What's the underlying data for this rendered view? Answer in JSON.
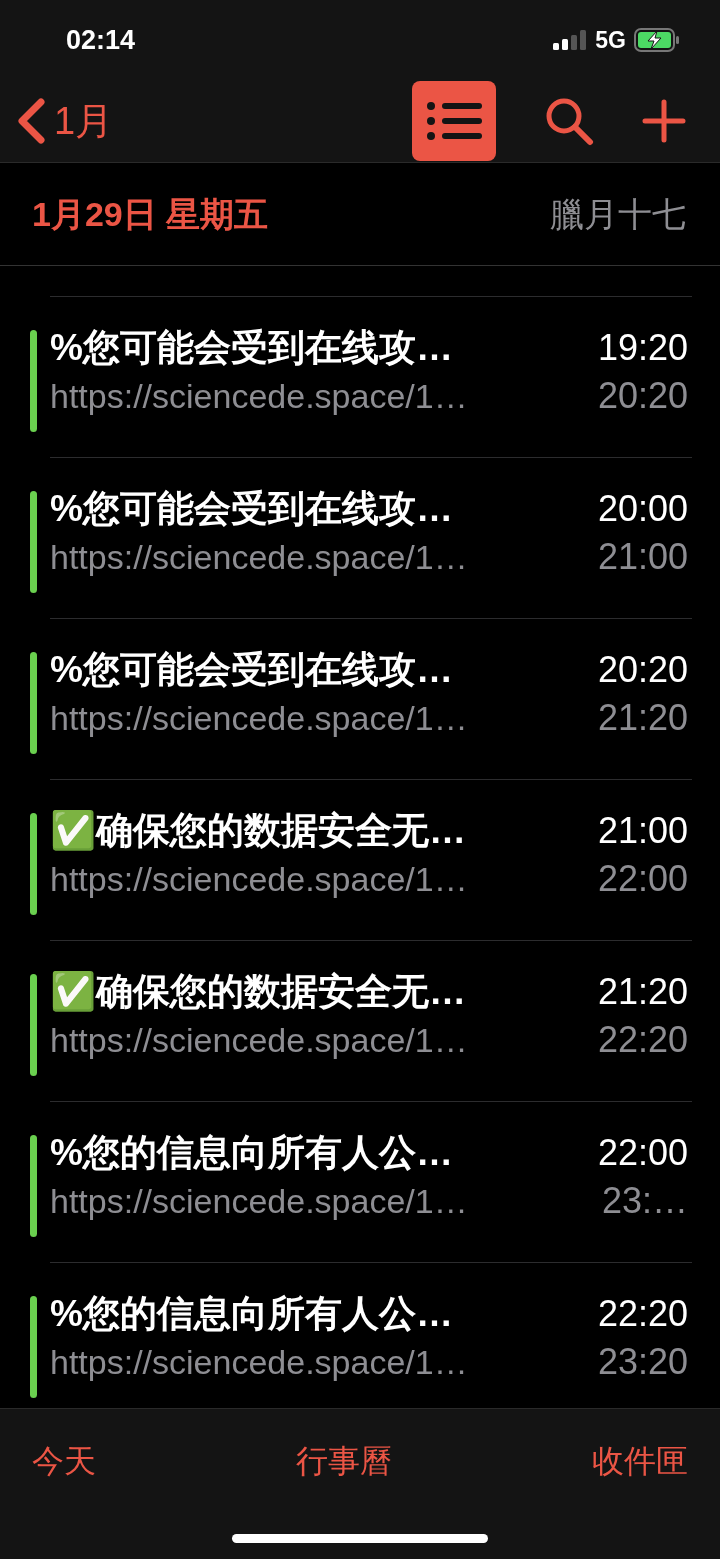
{
  "status_bar": {
    "time": "02:14",
    "network": "5G"
  },
  "nav": {
    "back_label": "1月",
    "list_view_selected": true
  },
  "day_header": {
    "date": "1月29日 星期五",
    "lunar": "臘月十七"
  },
  "events": [
    {
      "title": "%您可能会受到在线攻…",
      "location": "https://sciencede.space/1…",
      "start": "19:20",
      "end": "20:20",
      "color": "#6ad04f"
    },
    {
      "title": "%您可能会受到在线攻…",
      "location": "https://sciencede.space/1…",
      "start": "20:00",
      "end": "21:00",
      "color": "#6ad04f"
    },
    {
      "title": "%您可能会受到在线攻…",
      "location": "https://sciencede.space/1…",
      "start": "20:20",
      "end": "21:20",
      "color": "#6ad04f"
    },
    {
      "title": "✅确保您的数据安全无…",
      "location": "https://sciencede.space/1…",
      "start": "21:00",
      "end": "22:00",
      "color": "#6ad04f"
    },
    {
      "title": "✅确保您的数据安全无…",
      "location": "https://sciencede.space/1…",
      "start": "21:20",
      "end": "22:20",
      "color": "#6ad04f"
    },
    {
      "title": "%您的信息向所有人公…",
      "location": "https://sciencede.space/1…",
      "start": "22:00",
      "end": "23:…",
      "color": "#6ad04f"
    },
    {
      "title": "%您的信息向所有人公…",
      "location": "https://sciencede.space/1…",
      "start": "22:20",
      "end": "23:20",
      "color": "#6ad04f"
    }
  ],
  "tab_bar": [
    "今天",
    "行事曆",
    "收件匣"
  ]
}
